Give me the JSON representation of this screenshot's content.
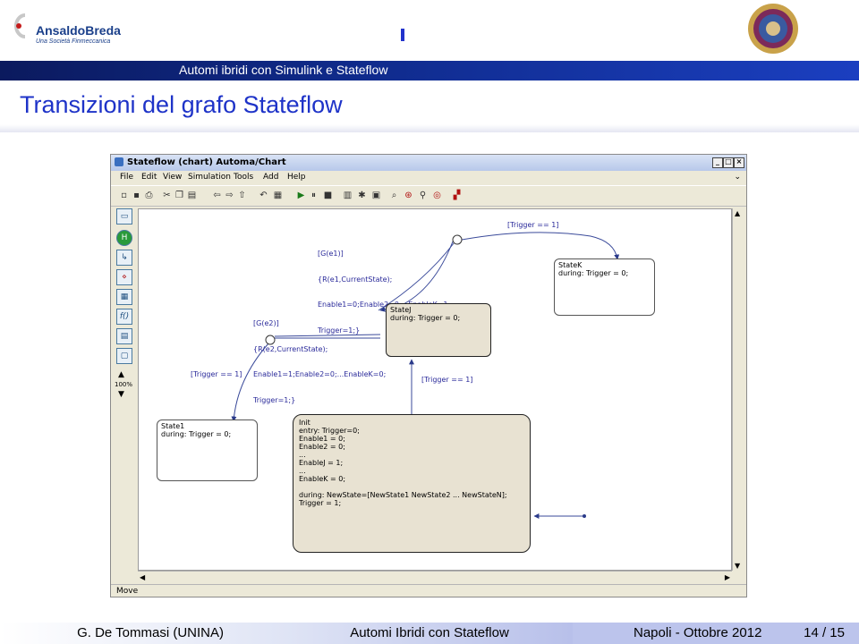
{
  "header": {
    "logo_name": "AnsaldoBreda",
    "logo_tagline": "Una Società Finmeccanica",
    "subtitle": "Automi ibridi con Simulink e Stateflow",
    "title": "Transizioni del grafo Stateflow"
  },
  "window": {
    "title": "Stateflow (chart) Automa/Chart",
    "menu": [
      "File",
      "Edit",
      "View",
      "Simulation",
      "Tools",
      "Add",
      "Help"
    ],
    "zoom": "100%",
    "status": "Move"
  },
  "chart": {
    "states": {
      "statek": {
        "name": "StateK",
        "body": [
          "during: Trigger = 0;"
        ]
      },
      "statej": {
        "name": "StateJ",
        "body": [
          "during: Trigger = 0;"
        ]
      },
      "state1": {
        "name": "State1",
        "body": [
          "during: Trigger = 0;"
        ]
      },
      "init": {
        "name": "Init",
        "body": [
          "entry: Trigger=0;",
          "Enable1 = 0;",
          "Enable2 = 0;",
          "...",
          "EnableJ = 1;",
          "...",
          "EnableK = 0;",
          "",
          "during: NewState=[NewState1 NewState2 ... NewStateN];",
          "Trigger = 1;"
        ]
      }
    },
    "labels": {
      "trans_k": [
        "[G(e1)]",
        "{R(e1,CurrentState);",
        "Enable1=0;Enable2=0;...EnableK=1;",
        "Trigger=1;}"
      ],
      "trans_j": [
        "[G(e2)]",
        "{R(e2,CurrentState);",
        "Enable1=1;Enable2=0;...EnableK=0;",
        "Trigger=1;}"
      ],
      "trigger_top": "[Trigger == 1]",
      "trigger_left": "[Trigger == 1]",
      "trigger_mid": "[Trigger == 1]"
    }
  },
  "footer": {
    "author": "G. De Tommasi  (UNINA)",
    "talk": "Automi Ibridi con Stateflow",
    "venue": "Napoli - Ottobre 2012",
    "page": "14 / 15"
  },
  "colors": {
    "title_blue": "#1e33c8",
    "bar_dark": "#0b1a5e",
    "state_fill": "#e8e2d2"
  }
}
